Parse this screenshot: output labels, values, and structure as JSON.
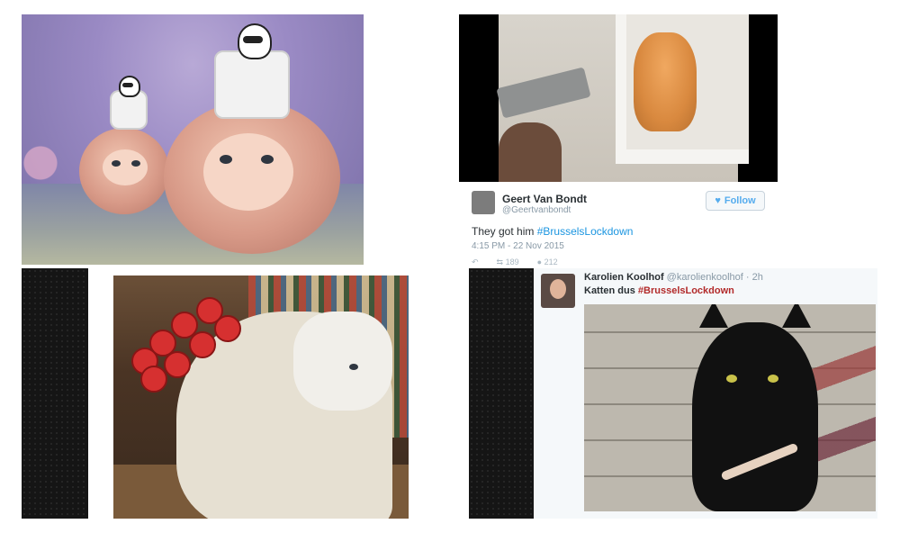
{
  "tweet1": {
    "name": "Geert Van Bondt",
    "handle": "@Geertvanbondt",
    "follow_label": "Follow",
    "text_prefix": "They got him",
    "hashtag": "#BrusselsLockdown",
    "timestamp": "4:15 PM - 22 Nov 2015",
    "retweets": "189",
    "likes": "212"
  },
  "tweet2": {
    "name": "Karolien Koolhof",
    "handle": "@karolienkoolhof",
    "age": "2h",
    "text_prefix": "Katten dus",
    "hashtag": "#BrusselsLockdown"
  },
  "colors": {
    "twitter_blue": "#1b95e0",
    "hashtag_red": "#b22a2a"
  }
}
